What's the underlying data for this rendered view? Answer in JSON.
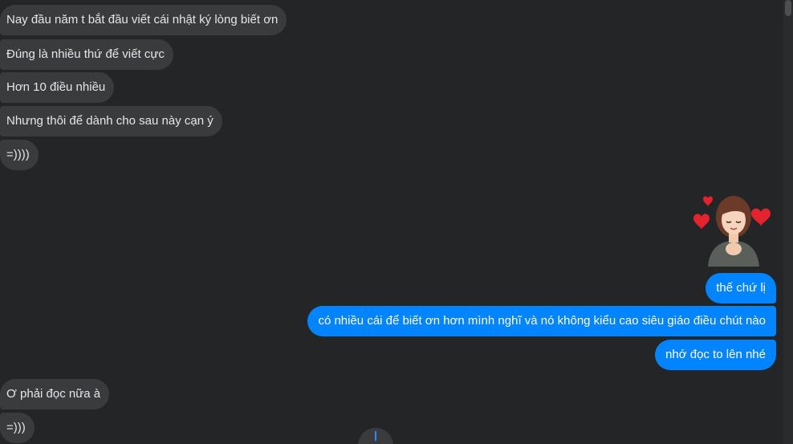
{
  "incoming_group_1": [
    "Nay đầu năm t bắt đầu viết cái nhật ký lòng biết ơn",
    "Đúng là nhiều thứ để viết cực",
    "Hơn 10 điều nhiều",
    "Nhưng thôi để dành cho sau này cạn ý",
    "=))))"
  ],
  "sticker": {
    "icon": "girl-with-hearts-sticker"
  },
  "outgoing_group": [
    "thế chứ lị",
    "có nhiều cái để biết ơn hơn mình nghĩ và nó không kiểu cao siêu giáo điều chút nào",
    "nhớ đọc to lên nhé"
  ],
  "incoming_group_2": [
    "Ơ phải đọc nữa à",
    "=)))"
  ],
  "scroll_down_button": {
    "icon": "arrow-down-icon"
  },
  "colors": {
    "background": "#242526",
    "incoming_bubble": "#3a3b3c",
    "outgoing_bubble": "#0084ff",
    "text": "#e4e6eb"
  }
}
